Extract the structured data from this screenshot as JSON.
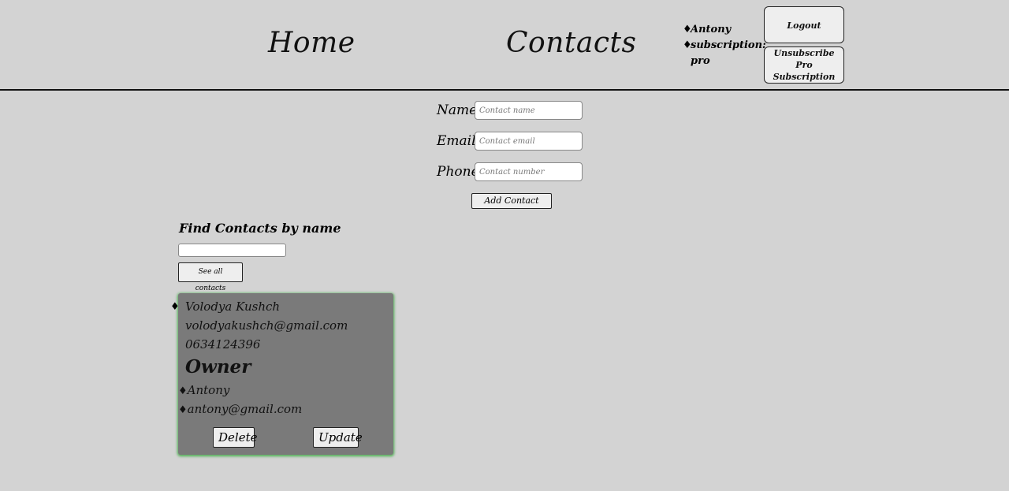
{
  "nav": {
    "home": "Home",
    "contacts": "Contacts"
  },
  "user": {
    "diamond": "♦",
    "name": "Antony",
    "subscription_label": "subscription:",
    "subscription_value": "pro"
  },
  "header_buttons": {
    "logout": "Logout",
    "unsubscribe": "Unsubscribe Pro Subscription"
  },
  "add_form": {
    "name_label": "Name",
    "name_placeholder": "Contact name",
    "email_label": "Email",
    "email_placeholder": "Contact email",
    "phone_label": "Phone",
    "phone_placeholder": "Contact number",
    "submit_label": "Add Contact"
  },
  "search": {
    "title": "Find Contacts by name",
    "value": "",
    "see_all_label": "See all contacts"
  },
  "contact_card": {
    "diamond": "♦",
    "name": "Volodya Kushch",
    "email": "volodyakushch@gmail.com",
    "phone": "0634124396",
    "owner_title": "Owner",
    "owner_name": "Antony",
    "owner_email": "antony@gmail.com",
    "delete_label": "Delete",
    "update_label": "Update",
    "accent_color": "#4caf50"
  }
}
